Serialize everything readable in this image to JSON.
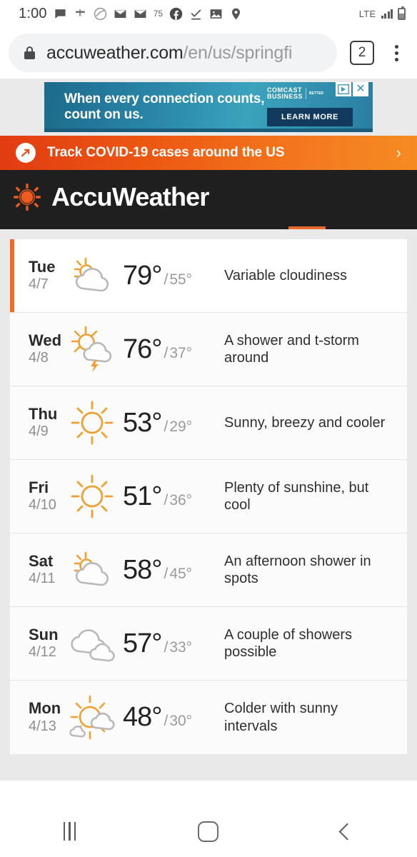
{
  "status_bar": {
    "time": "1:00",
    "notification_icons": [
      "chat-bubble-icon",
      "flag-icon",
      "taco-bell-icon",
      "envelope-icon",
      "envelope-icon",
      "image-icon",
      "location-pin-icon"
    ],
    "facebook_icon": "facebook-icon",
    "checkmark_icon": "checkmark-underline-icon",
    "badge_count": "75",
    "network": "LTE",
    "signal_icon": "signal-bars-icon",
    "battery_icon": "battery-icon"
  },
  "browser": {
    "lock_icon": "lock-icon",
    "url_host": "accuweather.com",
    "url_path": "/en/us/springfi",
    "url_full": "accuweather.com/en/us/springfi",
    "tab_count": "2",
    "menu_icon": "kebab-menu-icon"
  },
  "ad": {
    "headline_line1": "When every connection counts,",
    "headline_line2": "count on us.",
    "brand_line1": "COMCAST",
    "brand_line2": "BUSINESS",
    "brand_sub": "BETTER",
    "cta": "LEARN MORE",
    "adchoices_icon": "adchoices-icon",
    "close_icon": "close-icon"
  },
  "covid_banner": {
    "icon": "covid-arrow-icon",
    "text": "Track COVID-19 cases around the US",
    "chevron": "›",
    "gradient_start": "#e23c12",
    "gradient_end": "#f68b22"
  },
  "site_header": {
    "logo_icon": "accuweather-sun-logo",
    "title": "AccuWeather",
    "background": "#1f1f1f",
    "active_tab_accent": "#e8672a"
  },
  "forecast": {
    "accent_color": "#ef6c22",
    "days": [
      {
        "day": "Tue",
        "date": "4/7",
        "high": "79°",
        "sep": "/",
        "low": "55°",
        "description": "Variable cloudiness",
        "icon": "partly-cloudy-icon",
        "active": true
      },
      {
        "day": "Wed",
        "date": "4/8",
        "high": "76°",
        "sep": "/",
        "low": "37°",
        "description": "A shower and t-storm around",
        "icon": "sun-cloud-thunderstorm-icon",
        "active": false
      },
      {
        "day": "Thu",
        "date": "4/9",
        "high": "53°",
        "sep": "/",
        "low": "29°",
        "description": "Sunny, breezy and cooler",
        "icon": "sunny-icon",
        "active": false
      },
      {
        "day": "Fri",
        "date": "4/10",
        "high": "51°",
        "sep": "/",
        "low": "36°",
        "description": "Plenty of sunshine, but cool",
        "icon": "sunny-icon",
        "active": false
      },
      {
        "day": "Sat",
        "date": "4/11",
        "high": "58°",
        "sep": "/",
        "low": "45°",
        "description": "An afternoon shower in spots",
        "icon": "partly-cloudy-icon",
        "active": false
      },
      {
        "day": "Sun",
        "date": "4/12",
        "high": "57°",
        "sep": "/",
        "low": "33°",
        "description": "A couple of showers possible",
        "icon": "cloudy-icon",
        "active": false
      },
      {
        "day": "Mon",
        "date": "4/13",
        "high": "48°",
        "sep": "/",
        "low": "30°",
        "description": "Colder with sunny intervals",
        "icon": "sun-with-clouds-icon",
        "active": false
      }
    ]
  },
  "bottom_ad": {
    "adchoices_icon": "adchoices-icon",
    "close_icon": "close-icon"
  },
  "nav_bar": {
    "recents_label": "recents-button",
    "home_label": "home-button",
    "back_label": "back-button"
  }
}
